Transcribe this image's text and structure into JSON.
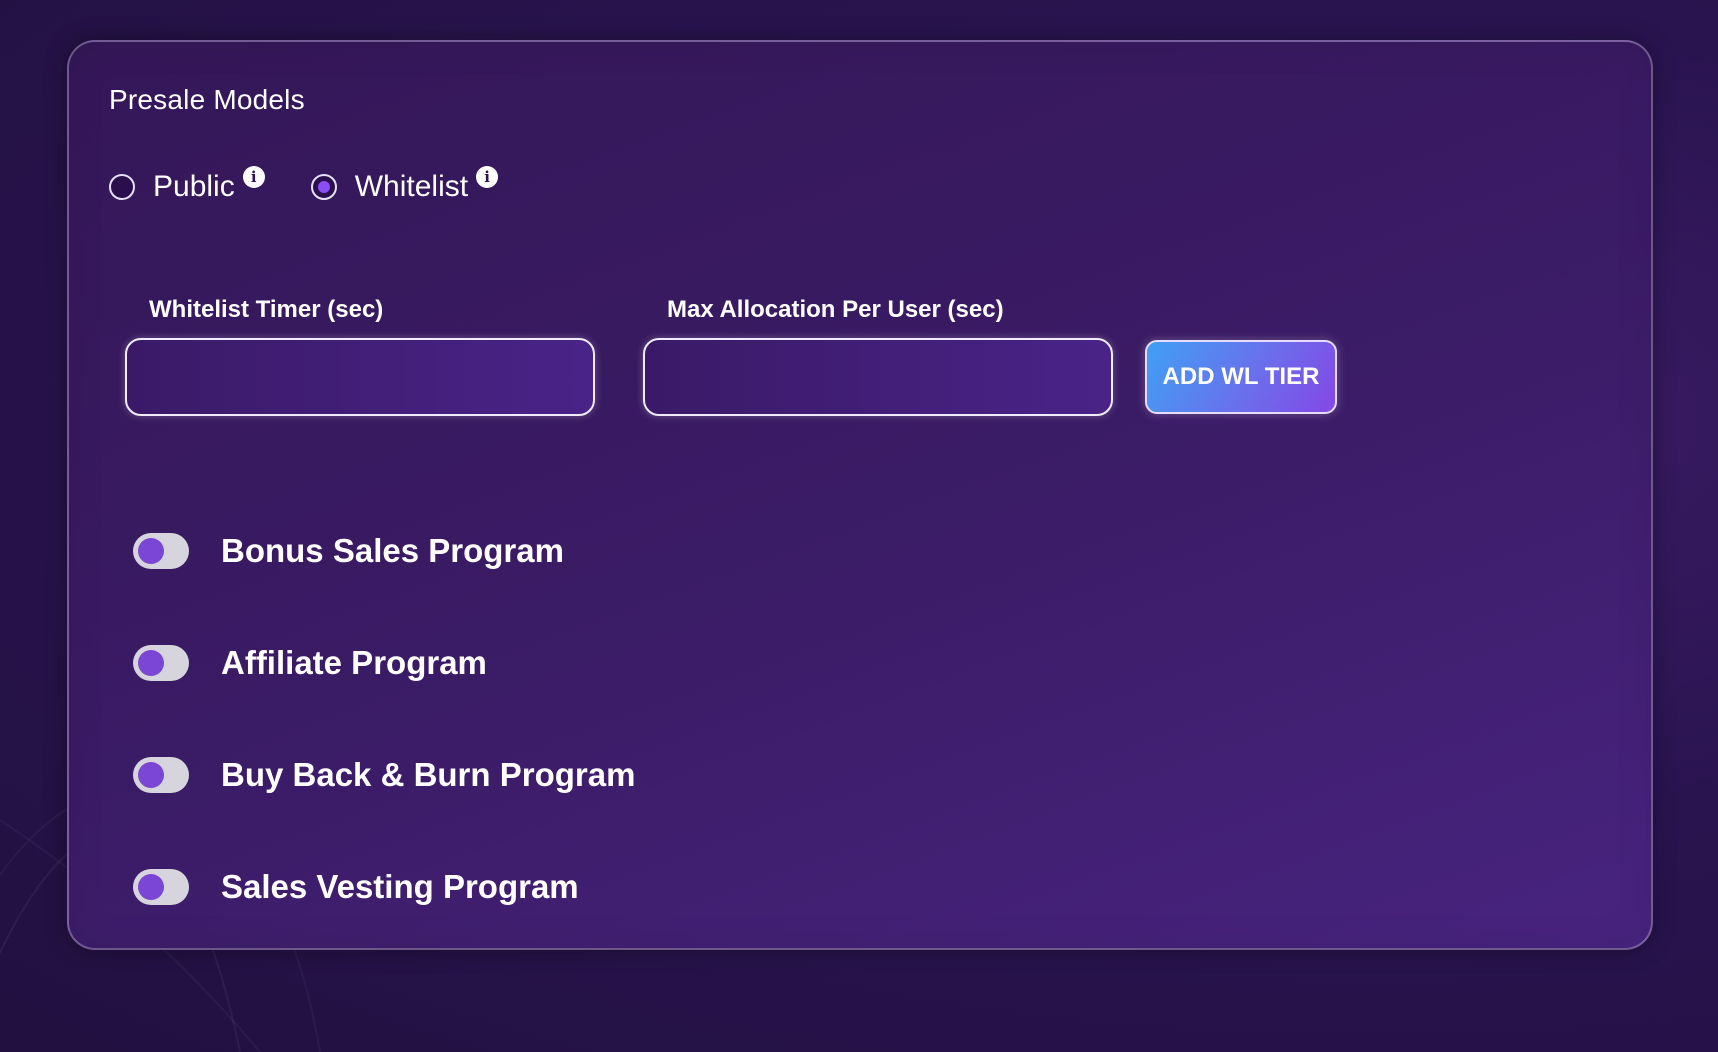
{
  "presale": {
    "title": "Presale Models",
    "models": [
      {
        "label": "Public",
        "selected": false,
        "info_icon": "info-icon"
      },
      {
        "label": "Whitelist",
        "selected": true,
        "info_icon": "info-icon"
      }
    ]
  },
  "fields": {
    "whitelist_timer": {
      "label": "Whitelist Timer (sec)",
      "value": "",
      "placeholder": ""
    },
    "max_allocation": {
      "label": "Max Allocation Per User (sec)",
      "value": "",
      "placeholder": ""
    }
  },
  "buttons": {
    "add_wl_tier": "ADD WL TIER"
  },
  "programs": [
    {
      "label": "Bonus Sales Program",
      "enabled": false
    },
    {
      "label": "Affiliate Program",
      "enabled": false
    },
    {
      "label": "Buy Back & Burn Program",
      "enabled": false
    },
    {
      "label": "Sales Vesting Program",
      "enabled": false
    }
  ],
  "colors": {
    "accent": "#8b4cf6",
    "knob": "#7b45d6",
    "toggle_track": "#d6d4dc",
    "button_gradient_start": "#3fa0f5",
    "button_gradient_end": "#8447e6"
  }
}
